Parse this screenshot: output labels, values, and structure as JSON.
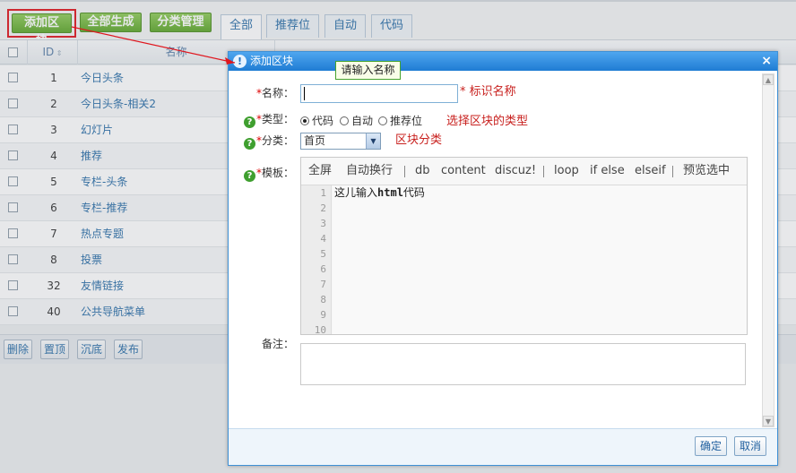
{
  "toolbar": {
    "add_block": "添加区块",
    "generate_all": "全部生成",
    "category_manage": "分类管理",
    "tabs": [
      "全部",
      "推荐位",
      "自动",
      "代码"
    ]
  },
  "table": {
    "headers": {
      "id": "ID",
      "name": "名称"
    },
    "rows": [
      {
        "id": "1",
        "name": "今日头条"
      },
      {
        "id": "2",
        "name": "今日头条-相关2"
      },
      {
        "id": "3",
        "name": "幻灯片"
      },
      {
        "id": "4",
        "name": "推荐"
      },
      {
        "id": "5",
        "name": "专栏-头条"
      },
      {
        "id": "6",
        "name": "专栏-推荐"
      },
      {
        "id": "7",
        "name": "热点专题"
      },
      {
        "id": "8",
        "name": "投票"
      },
      {
        "id": "32",
        "name": "友情链接"
      },
      {
        "id": "40",
        "name": "公共导航菜单"
      }
    ],
    "footer_buttons": [
      "删除",
      "置顶",
      "沉底",
      "发布"
    ]
  },
  "dialog": {
    "title": "添加区块",
    "close": "×",
    "name_label": "名称：",
    "name_value": "",
    "name_hint": "* 标识名称",
    "type_label": "类型：",
    "type_options": [
      "代码",
      "自动",
      "推荐位"
    ],
    "type_hint": "选择区块的类型",
    "category_label": "分类：",
    "category_value": "首页",
    "category_hint": "区块分类",
    "template_label": "模板：",
    "editor_toolbar": [
      "全屏",
      "自动换行",
      "db",
      "content",
      "discuz!",
      "loop",
      "if else",
      "elseif",
      "预览选中"
    ],
    "editor_line_numbers": [
      "1",
      "2",
      "3",
      "4",
      "5",
      "6",
      "7",
      "8",
      "9",
      "10"
    ],
    "editor_code_prefix": "这儿输入",
    "editor_code_tag": "html",
    "editor_code_suffix": "代码",
    "remark_label": "备注：",
    "ok": "确定",
    "cancel": "取消",
    "required_mark": "*",
    "help_mark": "?"
  },
  "tooltip": "请输入名称",
  "colors": {
    "accent_blue": "#1f7cd3",
    "green_button": "#5ea72b",
    "hint_red": "#c8201e",
    "annotation_red": "#e0161e"
  }
}
